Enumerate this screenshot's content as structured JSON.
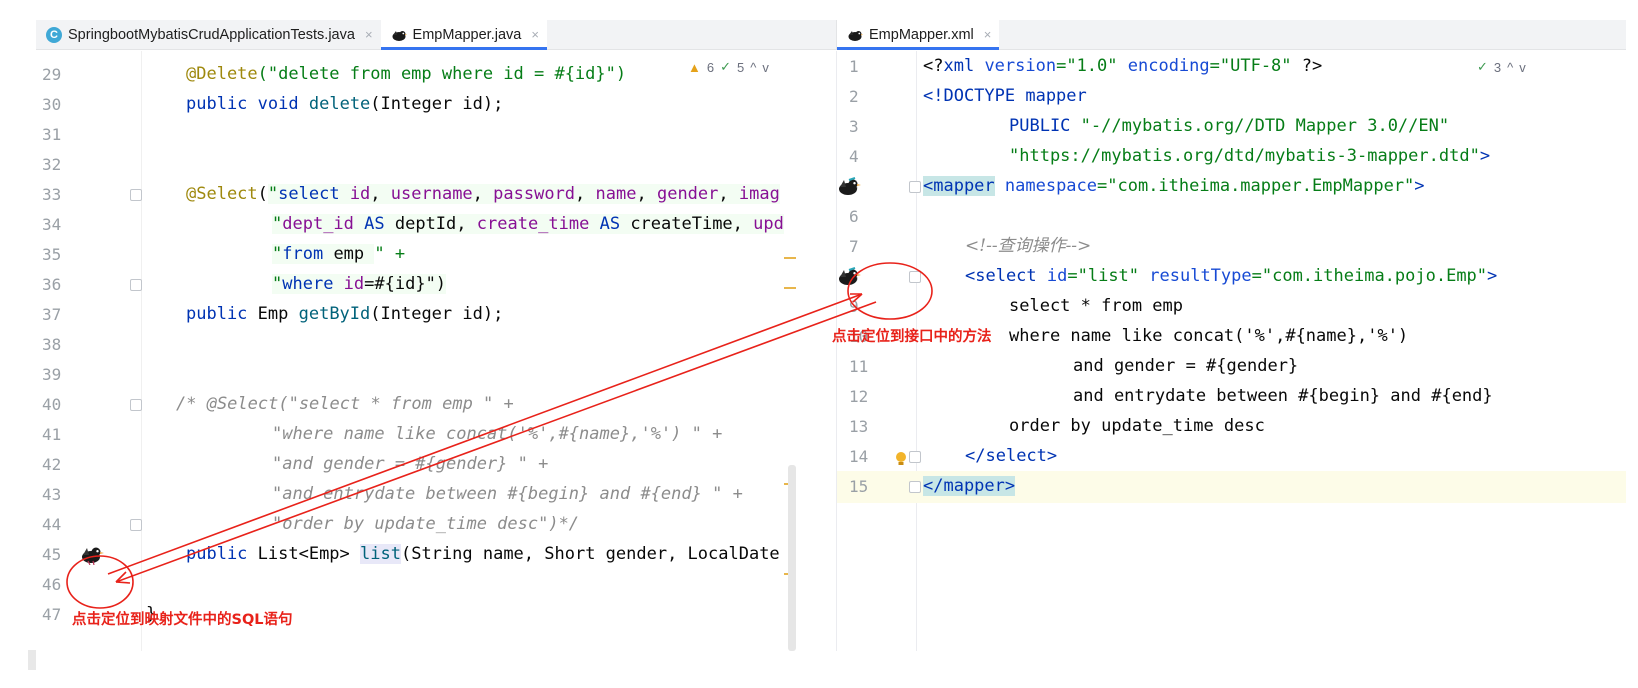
{
  "tabs_left": [
    {
      "label": "SpringbootMybatisCrudApplicationTests.java",
      "active": false,
      "icon": "class-icon"
    },
    {
      "label": "EmpMapper.java",
      "active": true,
      "icon": "mybatis-bird-icon"
    }
  ],
  "tabs_right": [
    {
      "label": "EmpMapper.xml",
      "active": true,
      "icon": "mybatis-bird-icon"
    }
  ],
  "tab_close_glyph": "×",
  "inspections_left": {
    "warnings": "6",
    "checks": "5"
  },
  "inspections_right": {
    "checks": "3"
  },
  "arrows": {
    "up": "^",
    "down": "v",
    "warn": "▲",
    "check": "✓"
  },
  "java_lines": [
    {
      "n": "29"
    },
    {
      "n": "30"
    },
    {
      "n": "31"
    },
    {
      "n": "32"
    },
    {
      "n": "33"
    },
    {
      "n": "34"
    },
    {
      "n": "35"
    },
    {
      "n": "36"
    },
    {
      "n": "37"
    },
    {
      "n": "38"
    },
    {
      "n": "39"
    },
    {
      "n": "40"
    },
    {
      "n": "41"
    },
    {
      "n": "42"
    },
    {
      "n": "43"
    },
    {
      "n": "44"
    },
    {
      "n": "45"
    },
    {
      "n": "46"
    },
    {
      "n": "47"
    }
  ],
  "java_code": {
    "l29_ann": "@Delete",
    "l29_str": "(\"delete from emp where id = #{id}\")",
    "l30_kw": "public",
    "l30_kw2": "void",
    "l30_fn": "delete",
    "l30_rest": "(Integer id);",
    "l33_ann": "@Select",
    "l33_p": "(",
    "l33_s1": "\"",
    "l33_k1": "select",
    "l33_f1": " id",
    "l33_c1": ", ",
    "l33_f2": "username",
    "l33_c2": ", ",
    "l33_f3": "password",
    "l33_c3": ", ",
    "l33_f4": "name",
    "l33_c4": ", ",
    "l33_f5": "gender",
    "l33_c5": ", ",
    "l33_f6": "imag",
    "l34_s": "\"",
    "l34_f1": "dept_id",
    "l34_k1": " AS ",
    "l34_a1": "deptId",
    "l34_c1": ", ",
    "l34_f2": "create_time",
    "l34_k2": " AS ",
    "l34_a2": "createTime",
    "l34_c2": ", ",
    "l34_f3": "upd",
    "l35_s": "\"",
    "l35_k": "from",
    "l35_t": " emp ",
    "l35_e": "\" +",
    "l36_s": "\"",
    "l36_k": "where",
    "l36_f": " id",
    "l36_e": "=#{id}\")",
    "l37_kw": "public",
    "l37_t": " Emp ",
    "l37_fn": "getById",
    "l37_rest": "(Integer id);",
    "l40": "/* @Select(\"select * from emp \" +",
    "l41": "\"where name like concat('%',#{name},'%') \" +",
    "l42": "\"and gender = #{gender} \" +",
    "l43": "\"and entrydate between #{begin} and #{end} \" +",
    "l44": "\"order by update_time desc\")*/",
    "l45_kw": "public",
    "l45_t": " List<Emp> ",
    "l45_fn": "list",
    "l45_rest": "(String name, Short gender, LocalDate",
    "l47": "}"
  },
  "xml_lines": [
    {
      "n": "1"
    },
    {
      "n": "2"
    },
    {
      "n": "3"
    },
    {
      "n": "4"
    },
    {
      "n": "5"
    },
    {
      "n": "6"
    },
    {
      "n": "7"
    },
    {
      "n": "8"
    },
    {
      "n": "9"
    },
    {
      "n": "10"
    },
    {
      "n": "11"
    },
    {
      "n": "12"
    },
    {
      "n": "13"
    },
    {
      "n": "14"
    },
    {
      "n": "15"
    }
  ],
  "xml_code": {
    "l1_a": "<?",
    "l1_b": "xml",
    "l1_c": " version",
    "l1_d": "=\"1.0\"",
    "l1_e": " encoding",
    "l1_f": "=\"UTF-8\"",
    "l1_g": " ?>",
    "l2_a": "<!DOCTYPE mapper",
    "l3_a": "PUBLIC ",
    "l3_b": "\"-//mybatis.org//DTD Mapper 3.0//EN\"",
    "l4_a": "\"https://mybatis.org/dtd/mybatis-3-mapper.dtd\"",
    "l4_b": ">",
    "l5_a": "<mapper",
    "l5_b": " namespace",
    "l5_c": "=\"com.itheima.mapper.EmpMapper\"",
    "l5_d": ">",
    "l7_a": "<!--查询操作-->",
    "l8_a": "<select",
    "l8_b": " id",
    "l8_c": "=\"list\"",
    "l8_d": " resultType",
    "l8_e": "=\"com.itheima.pojo.Emp\"",
    "l8_f": ">",
    "l9": "select * from emp",
    "l10": "where name like concat('%',#{name},'%')",
    "l11": "and gender = #{gender}",
    "l12": "and entrydate between #{begin} and #{end}",
    "l13": "order by update_time desc",
    "l14_a": "</",
    "l14_b": "select",
    "l14_c": ">",
    "l15_a": "</mapper",
    "l15_b": ">"
  },
  "annotations": {
    "right_label": "点击定位到接口中的方法",
    "left_label": "点击定位到映射文件中的SQL语句"
  },
  "colors": {
    "annotation_red": "#e8221a",
    "active_tab_accent": "#3574f0",
    "keyword_blue": "#0033b3",
    "string_green": "#067d17",
    "annotation_yellow": "#9e880d"
  }
}
